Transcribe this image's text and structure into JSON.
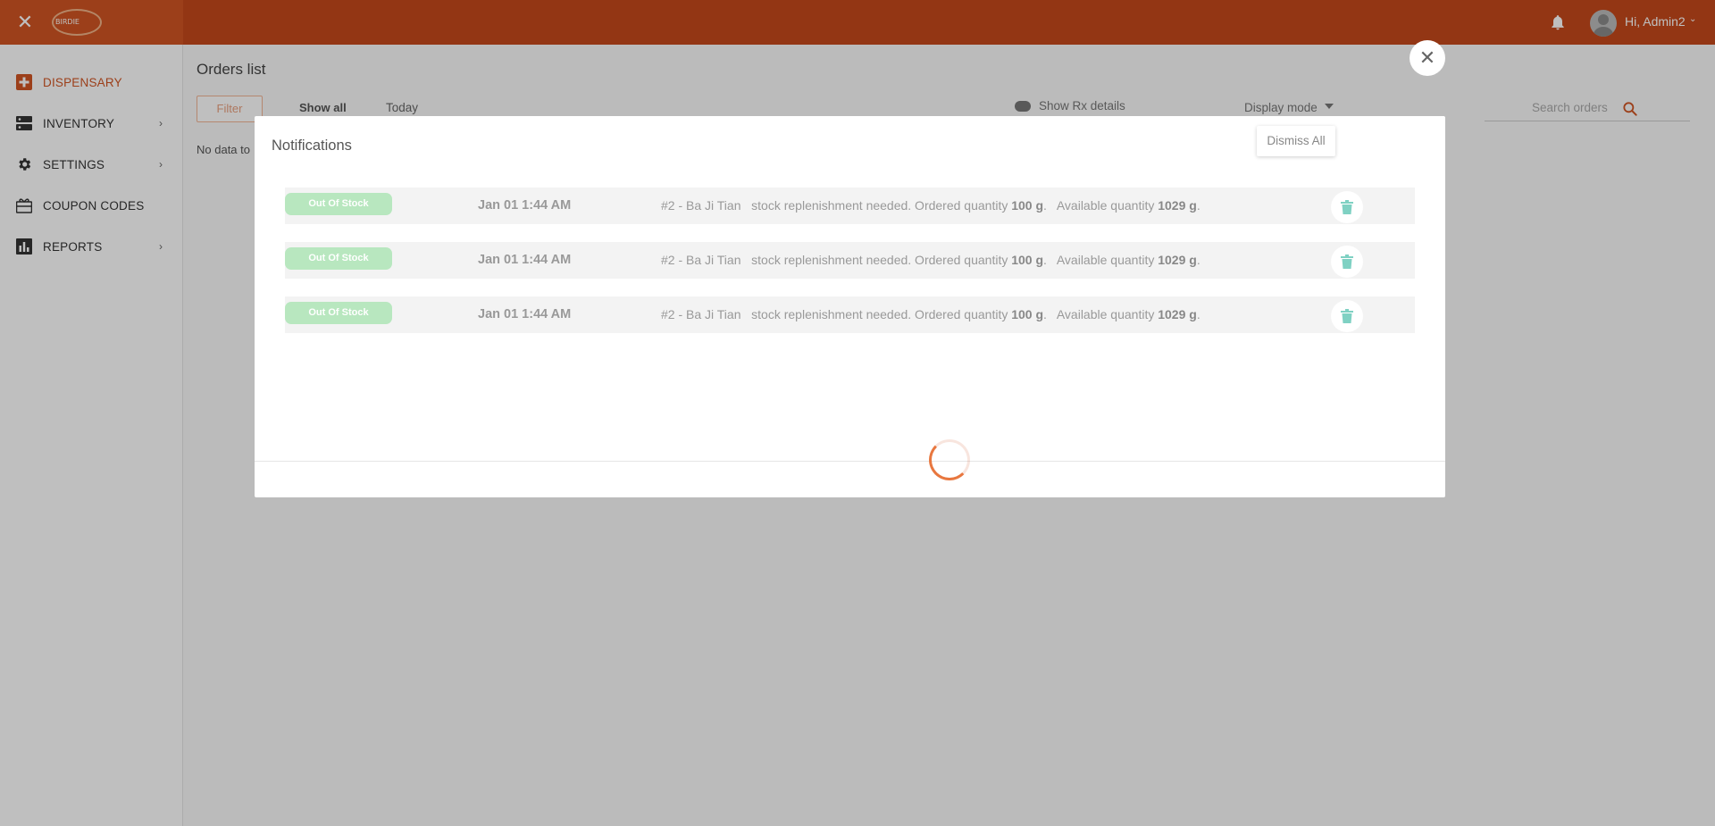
{
  "header": {
    "logo_text": "BIRDIE",
    "user_greeting": "Hi, Admin2",
    "colors": {
      "bar": "#c4491b",
      "accent": "#d05523"
    }
  },
  "sidebar": {
    "items": [
      {
        "label": "DISPENSARY",
        "icon": "plus-square-icon",
        "active": true
      },
      {
        "label": "INVENTORY",
        "icon": "server-icon",
        "has_submenu": true
      },
      {
        "label": "SETTINGS",
        "icon": "gear-icon",
        "has_submenu": true
      },
      {
        "label": "COUPON CODES",
        "icon": "gift-card-icon"
      },
      {
        "label": "REPORTS",
        "icon": "bar-chart-icon",
        "has_submenu": true
      }
    ]
  },
  "main": {
    "title": "Orders list",
    "filter_label": "Filter",
    "tabs": [
      "Show all",
      "Today"
    ],
    "rx_toggle_label": "Show Rx details",
    "display_mode_label": "Display mode",
    "search_placeholder": "Search orders",
    "empty_text": "No data to"
  },
  "modal": {
    "title": "Notifications",
    "dismiss_label": "Dismiss All",
    "close_glyph": "✕",
    "loading": true,
    "rows": [
      {
        "badge": "Out Of Stock",
        "time": "Jan 01 1:44 AM",
        "ref": "#2 - Ba Ji Tian",
        "text_pre": "stock replenishment needed. Ordered quantity",
        "ordered": "100 g",
        "text_mid": "Available quantity",
        "available": "1029 g"
      },
      {
        "badge": "Out Of Stock",
        "time": "Jan 01 1:44 AM",
        "ref": "#2 - Ba Ji Tian",
        "text_pre": "stock replenishment needed. Ordered quantity",
        "ordered": "100 g",
        "text_mid": "Available quantity",
        "available": "1029 g"
      },
      {
        "badge": "Out Of Stock",
        "time": "Jan 01 1:44 AM",
        "ref": "#2 - Ba Ji Tian",
        "text_pre": "stock replenishment needed. Ordered quantity",
        "ordered": "100 g",
        "text_mid": "Available quantity",
        "available": "1029 g"
      }
    ]
  }
}
